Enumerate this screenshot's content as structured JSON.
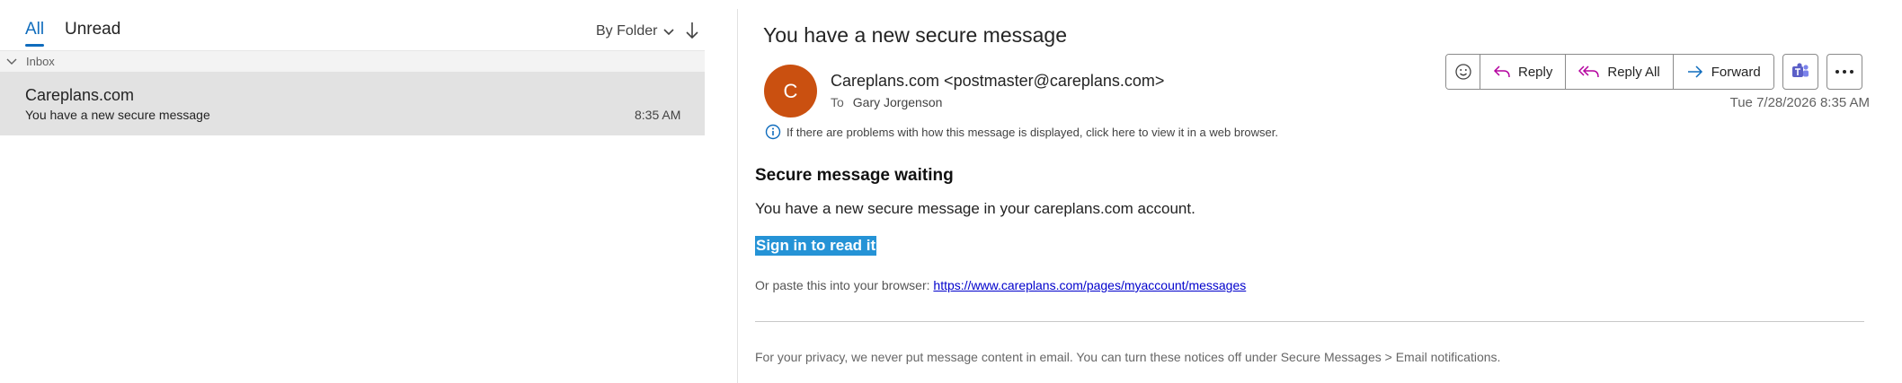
{
  "list": {
    "tabs": {
      "all": "All",
      "unread": "Unread"
    },
    "sort_label": "By Folder",
    "folder_label": "Inbox",
    "message": {
      "sender": "Careplans.com",
      "subject": "You have a new secure message",
      "time": "8:35 AM"
    }
  },
  "reading": {
    "subject": "You have a new secure message",
    "avatar_letter": "C",
    "from": "Careplans.com <postmaster@careplans.com>",
    "to_label": "To",
    "to_name": "Gary Jorgenson",
    "date": "Tue 7/28/2026 8:35 AM",
    "info": "If there are problems with how this message is displayed, click here to view it in a web browser.",
    "toolbar": {
      "reply": "Reply",
      "reply_all": "Reply All",
      "forward": "Forward"
    },
    "body": {
      "heading": "Secure message waiting",
      "line1": "You have a new secure message in your careplans.com account.",
      "sign_in": "Sign in to read it",
      "paste_prefix": "Or paste this into your browser:",
      "paste_url": "https://www.careplans.com/pages/myaccount/messages",
      "footer": "For your privacy, we never put message content in email. You can turn these notices off under Secure Messages > Email notifications."
    }
  },
  "colors": {
    "accent": "#0f6cbd",
    "avatar": "#ca5010",
    "selected_row": "#e2e2e2",
    "link_highlight": "#2593d6"
  },
  "icons": [
    "chevron-down-icon",
    "sort-arrow-down-icon",
    "emoji-icon",
    "reply-icon",
    "reply-all-icon",
    "forward-icon",
    "teams-icon",
    "more-icon",
    "info-icon"
  ]
}
